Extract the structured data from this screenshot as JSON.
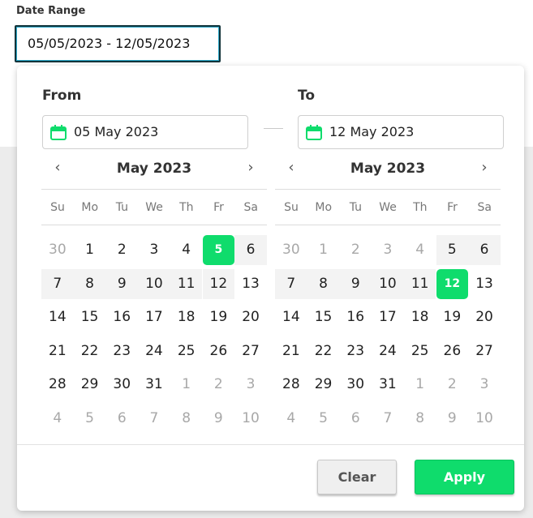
{
  "field": {
    "label": "Date Range",
    "value": "05/05/2023 - 12/05/2023"
  },
  "popup": {
    "from_label": "From",
    "to_label": "To",
    "from_value": "05 May 2023",
    "to_value": "12 May 2023",
    "clear_label": "Clear",
    "apply_label": "Apply",
    "accent_color": "#0fdc6c"
  },
  "weekdays": [
    "Su",
    "Mo",
    "Tu",
    "We",
    "Th",
    "Fr",
    "Sa"
  ],
  "calendars": [
    {
      "month_title": "May 2023",
      "prev_icon": "‹",
      "next_icon": "›",
      "days": [
        "30",
        "1",
        "2",
        "3",
        "4",
        "5",
        "6",
        "7",
        "8",
        "9",
        "10",
        "11",
        "12",
        "13",
        "14",
        "15",
        "16",
        "17",
        "18",
        "19",
        "20",
        "21",
        "22",
        "23",
        "24",
        "25",
        "26",
        "27",
        "28",
        "29",
        "30",
        "31",
        "1",
        "2",
        "3",
        "4",
        "5",
        "6",
        "7",
        "8",
        "9",
        "10"
      ],
      "muted": [
        0,
        32,
        33,
        34,
        35,
        36,
        37,
        38,
        39,
        40,
        41
      ],
      "selected": [
        5
      ],
      "in_range": [
        6,
        7,
        8,
        9,
        10,
        11,
        12
      ]
    },
    {
      "month_title": "May 2023",
      "prev_icon": "‹",
      "next_icon": "›",
      "days": [
        "30",
        "1",
        "2",
        "3",
        "4",
        "5",
        "6",
        "7",
        "8",
        "9",
        "10",
        "11",
        "12",
        "13",
        "14",
        "15",
        "16",
        "17",
        "18",
        "19",
        "20",
        "21",
        "22",
        "23",
        "24",
        "25",
        "26",
        "27",
        "28",
        "29",
        "30",
        "31",
        "1",
        "2",
        "3",
        "4",
        "5",
        "6",
        "7",
        "8",
        "9",
        "10"
      ],
      "muted": [
        0,
        1,
        2,
        3,
        4,
        32,
        33,
        34,
        35,
        36,
        37,
        38,
        39,
        40,
        41
      ],
      "selected": [
        12
      ],
      "in_range": [
        5,
        6,
        7,
        8,
        9,
        10,
        11
      ]
    }
  ]
}
